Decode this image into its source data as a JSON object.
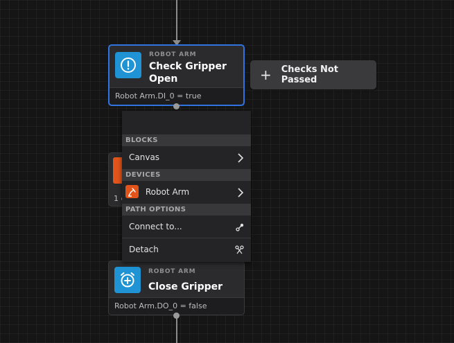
{
  "check_node": {
    "kind": "ROBOT ARM",
    "title_line1": "Check Gripper",
    "title_line2": "Open",
    "condition": "Robot Arm.DI_0 = true"
  },
  "checks_button": {
    "label": "Checks Not Passed",
    "icon": "plus-icon"
  },
  "partial_node": {
    "footer_fragment": "1 c"
  },
  "menu": {
    "sections": {
      "blocks": "BLOCKS",
      "devices": "DEVICES",
      "path_options": "PATH OPTIONS"
    },
    "items": {
      "canvas": "Canvas",
      "robot_arm": "Robot Arm",
      "connect": "Connect to...",
      "detach": "Detach"
    }
  },
  "close_node": {
    "kind": "ROBOT ARM",
    "title": "Close Gripper",
    "condition": "Robot Arm.DO_0 = false"
  },
  "colors": {
    "accent_blue": "#2f74e0",
    "node_icon_blue": "#1f93d3",
    "device_orange": "#e3541b",
    "background": "#151515"
  }
}
